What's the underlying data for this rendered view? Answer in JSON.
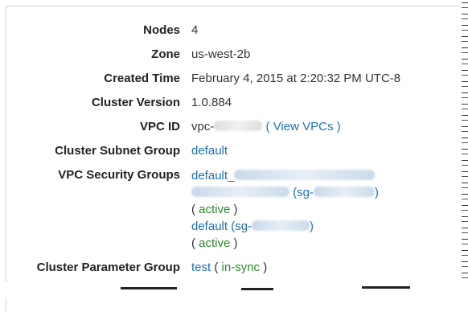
{
  "details": {
    "nodes": {
      "label": "Nodes",
      "value": "4"
    },
    "zone": {
      "label": "Zone",
      "value": "us-west-2b"
    },
    "created_time": {
      "label": "Created Time",
      "value": "February 4, 2015 at 2:20:32 PM UTC-8"
    },
    "cluster_version": {
      "label": "Cluster Version",
      "value": "1.0.884"
    },
    "vpc_id": {
      "label": "VPC ID",
      "prefix": "vpc-",
      "view_link": "View VPCs",
      "open_paren": "(",
      "close_paren": ")"
    },
    "cluster_subnet_group": {
      "label": "Cluster Subnet Group",
      "value": "default"
    },
    "vpc_security_groups": {
      "label": "VPC Security Groups",
      "group1_prefix": "default_",
      "group1_sg_prefix": "(sg-",
      "group1_sg_suffix": ")",
      "group1_status": "active",
      "group2_prefix": "default (sg-",
      "group2_suffix": ")",
      "group2_status": "active",
      "open_paren": "(",
      "close_paren": ")"
    },
    "cluster_parameter_group": {
      "label": "Cluster Parameter Group",
      "value": "test",
      "status": "in-sync",
      "open_paren": "(",
      "close_paren": ")"
    }
  }
}
